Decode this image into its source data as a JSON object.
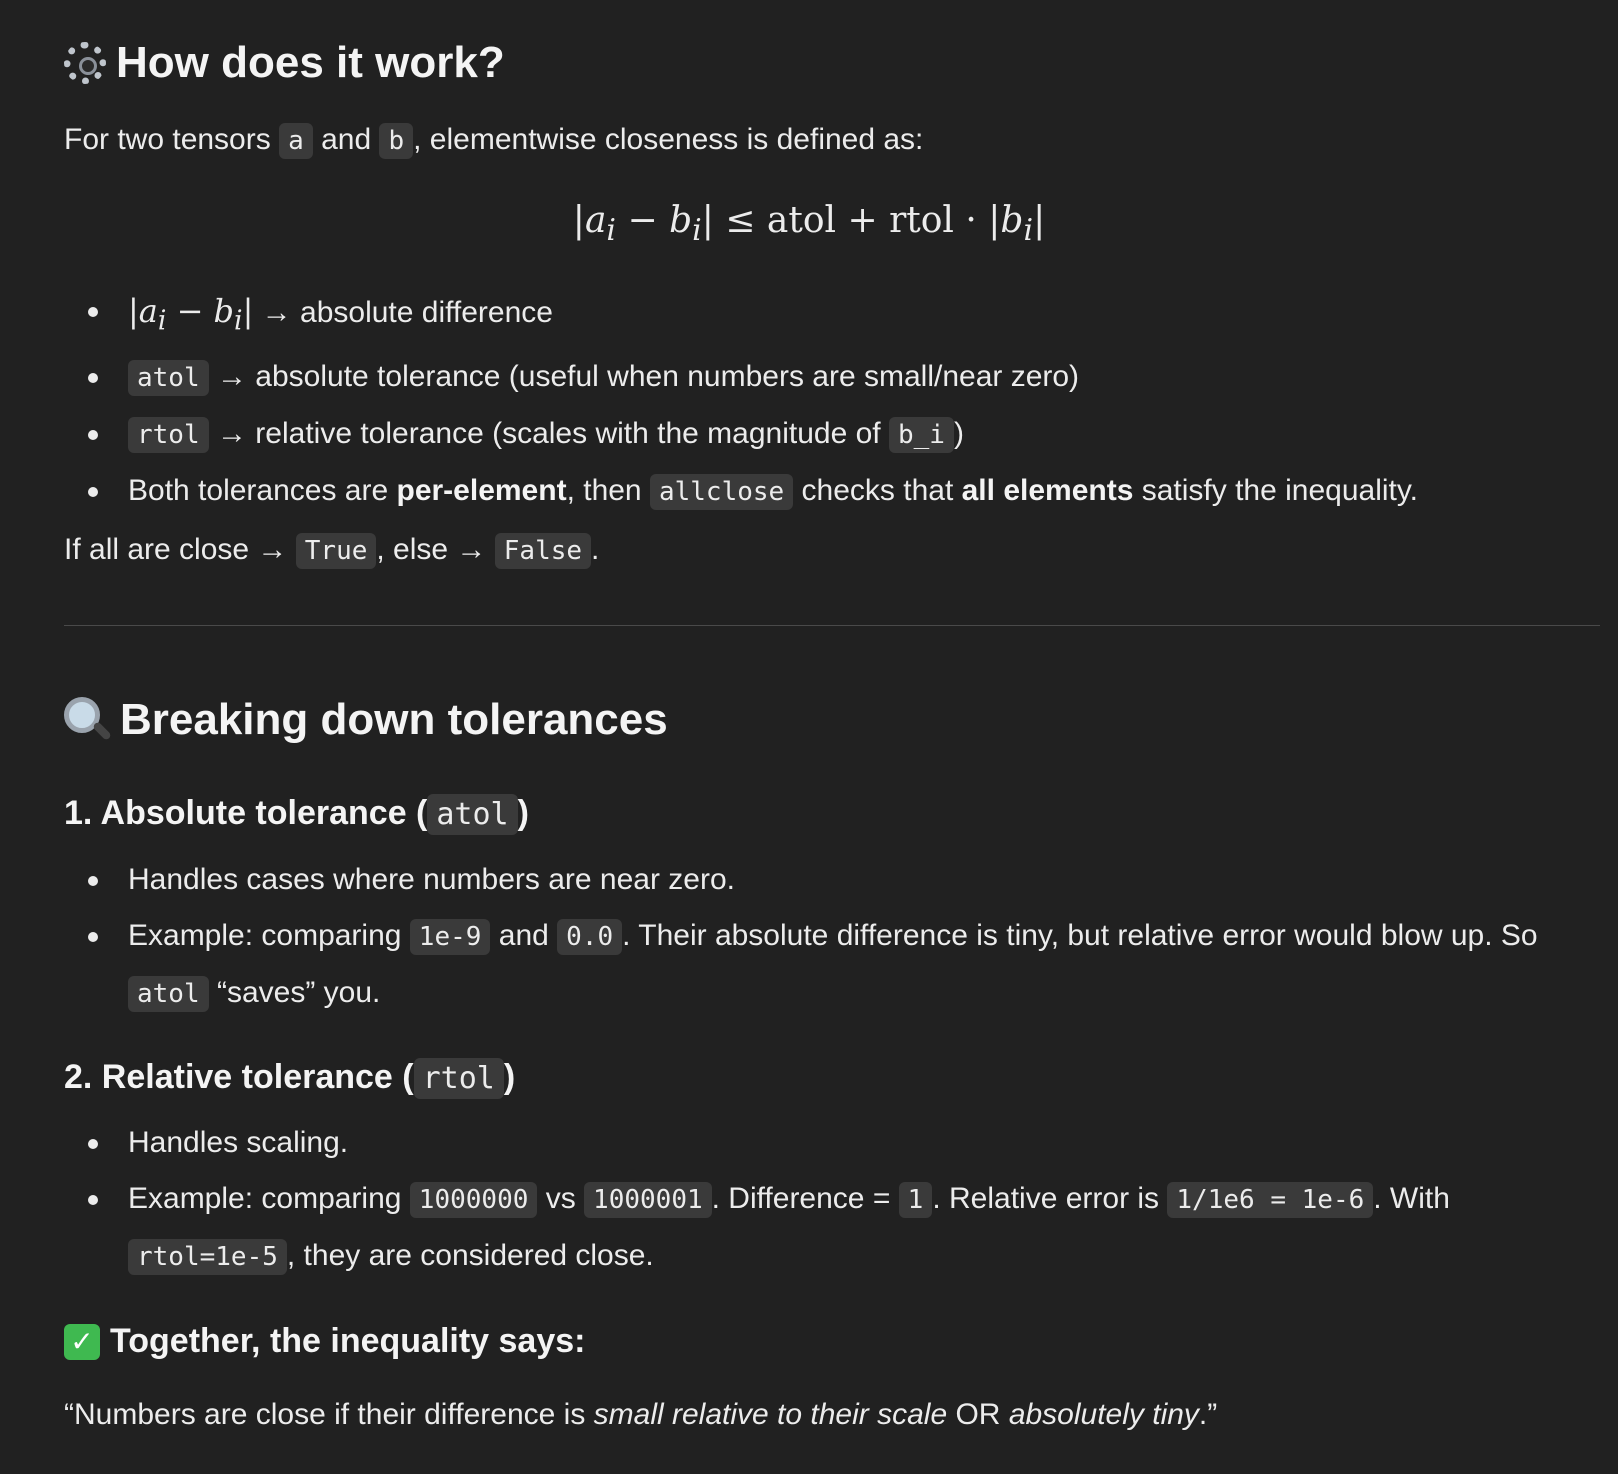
{
  "section1": {
    "title": "How does it work?",
    "icon": "gear-icon",
    "intro_1": "For two tensors ",
    "intro_a": "a",
    "intro_2": " and ",
    "intro_b": "b",
    "intro_3": ", elementwise closeness is defined as:",
    "bullets": {
      "b1_text": " → absolute difference",
      "b2_code": "atol",
      "b2_text": " → absolute tolerance (useful when numbers are small/near zero)",
      "b3_code": "rtol",
      "b3_text": " → relative tolerance (scales with the magnitude of ",
      "b3_code2": "b_i",
      "b3_end": ")",
      "b4_1": "Both tolerances are ",
      "b4_bold1": "per-element",
      "b4_2": ", then ",
      "b4_code": "allclose",
      "b4_3": " checks that ",
      "b4_bold2": "all elements",
      "b4_4": " satisfy the inequality."
    },
    "result_1": "If all are close → ",
    "result_true": "True",
    "result_2": ", else → ",
    "result_false": "False",
    "result_3": "."
  },
  "section2": {
    "title": "Breaking down tolerances",
    "icon": "magnifier-icon",
    "sub1": {
      "title_1": "1. Absolute tolerance (",
      "title_code": "atol",
      "title_2": ")",
      "b1": "Handles cases where numbers are near zero.",
      "b2_1": "Example: comparing ",
      "b2_c1": "1e-9",
      "b2_2": " and ",
      "b2_c2": "0.0",
      "b2_3": ". Their absolute difference is tiny, but relative error would blow up. So ",
      "b2_c3": "atol",
      "b2_4": " “saves” you."
    },
    "sub2": {
      "title_1": "2. Relative tolerance (",
      "title_code": "rtol",
      "title_2": ")",
      "b1": "Handles scaling.",
      "b2_1": "Example: comparing ",
      "b2_c1": "1000000",
      "b2_2": " vs ",
      "b2_c2": "1000001",
      "b2_3": ". Difference = ",
      "b2_c3": "1",
      "b2_4": ". Relative error is ",
      "b2_c4": "1/1e6 = 1e-6",
      "b2_5": ". With ",
      "b2_c5": "rtol=1e-5",
      "b2_6": ", they are considered close."
    },
    "together_title": "Together, the inequality says:",
    "together_icon": "check-icon",
    "quote_1": "“Numbers are close if their difference is ",
    "quote_em1": "small relative to their scale",
    "quote_2": " OR ",
    "quote_em2": "absolutely tiny",
    "quote_3": ".”"
  }
}
